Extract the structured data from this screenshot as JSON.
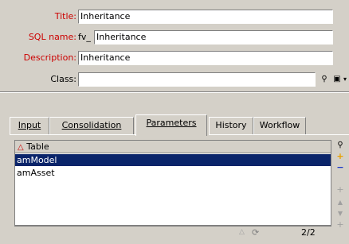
{
  "form": {
    "title": {
      "label": "Title:",
      "value": "Inheritance"
    },
    "sql_name": {
      "label": "SQL name:",
      "prefix": "fv_",
      "value": "Inheritance"
    },
    "description": {
      "label": "Description:",
      "value": "Inheritance"
    },
    "class": {
      "label": "Class:",
      "value": ""
    }
  },
  "tabs": [
    {
      "label": "Input"
    },
    {
      "label": "Consolidation"
    },
    {
      "label": "Parameters",
      "active": true
    },
    {
      "label": "History"
    },
    {
      "label": "Workflow"
    }
  ],
  "table": {
    "header": "Table",
    "rows": [
      {
        "value": "amModel",
        "selected": true
      },
      {
        "value": "amAsset",
        "selected": false
      }
    ]
  },
  "status": {
    "count": "2/2"
  },
  "colors": {
    "required": "#cc0000",
    "selection": "#0a246a",
    "add": "#e8a000",
    "remove": "#1c3cc8"
  }
}
